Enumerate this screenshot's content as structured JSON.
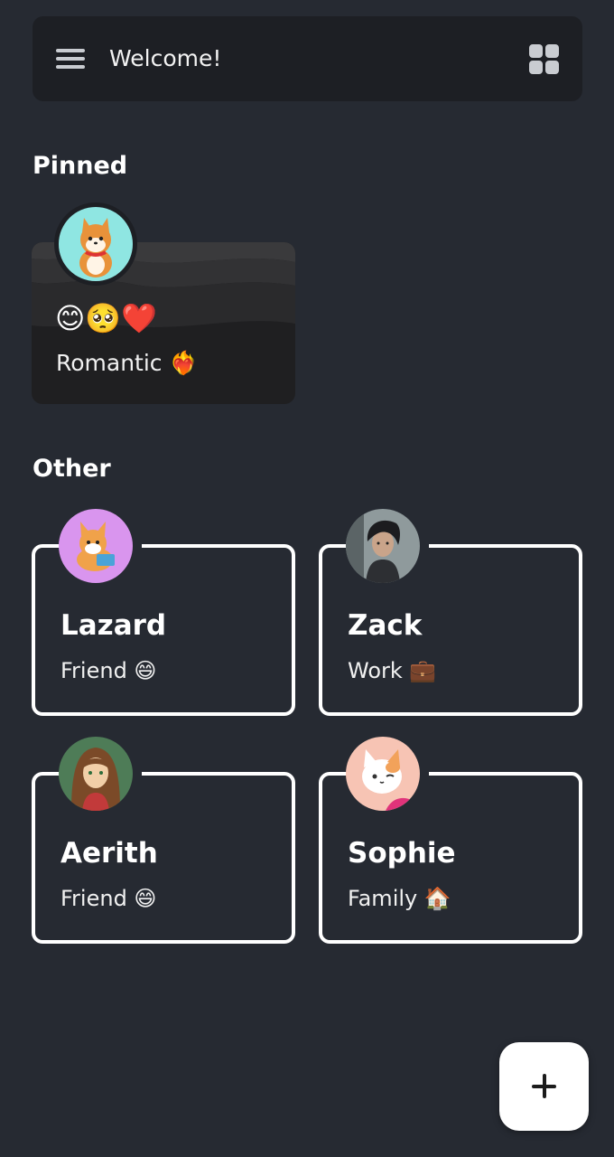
{
  "header": {
    "title": "Welcome!",
    "menu_icon": "hamburger-menu-icon",
    "layout_icon": "grid-view-icon"
  },
  "sections": {
    "pinned_title": "Pinned",
    "other_title": "Other"
  },
  "pinned": [
    {
      "emojis": "😊🥺❤️",
      "label": "Romantic ❤️‍🔥",
      "avatar": "shiba-dog-avatar"
    }
  ],
  "contacts": [
    {
      "name": "Lazard",
      "tag": "Friend 😄",
      "avatar": "corgi-reading-avatar"
    },
    {
      "name": "Zack",
      "tag": "Work 💼",
      "avatar": "dark-haired-man-avatar"
    },
    {
      "name": "Aerith",
      "tag": "Friend 😄",
      "avatar": "brown-haired-woman-avatar"
    },
    {
      "name": "Sophie",
      "tag": "Family 🏠",
      "avatar": "white-cat-avatar"
    }
  ],
  "fab": {
    "icon": "plus-icon"
  },
  "colors": {
    "background": "#262a32",
    "topbar": "#1d1f24",
    "card_border": "#ffffff",
    "fab": "#ffffff"
  }
}
